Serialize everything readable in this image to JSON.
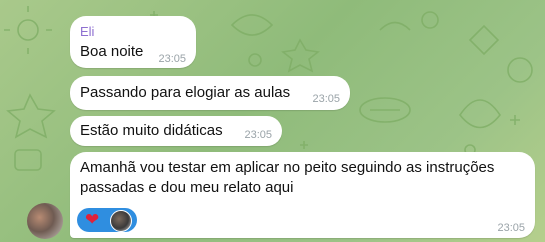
{
  "sender": {
    "name": "Eli"
  },
  "messages": [
    {
      "text": "Boa noite",
      "time": "23:05"
    },
    {
      "text": "Passando para elogiar as aulas",
      "time": "23:05"
    },
    {
      "text": "Estão muito didáticas",
      "time": "23:05"
    },
    {
      "text_line1": "Amanhã vou testar em aplicar no peito seguindo as instruções",
      "text_line2": "passadas e dou meu relato aqui",
      "time": "23:05",
      "reaction": {
        "emoji": "❤",
        "count_avatars": 1
      }
    }
  ],
  "colors": {
    "bubble": "#ffffff",
    "sender_name": "#8e6fd0",
    "time": "#9aa3a8",
    "reaction_pill": "#2f8ee0",
    "heart": "#e0213a"
  }
}
